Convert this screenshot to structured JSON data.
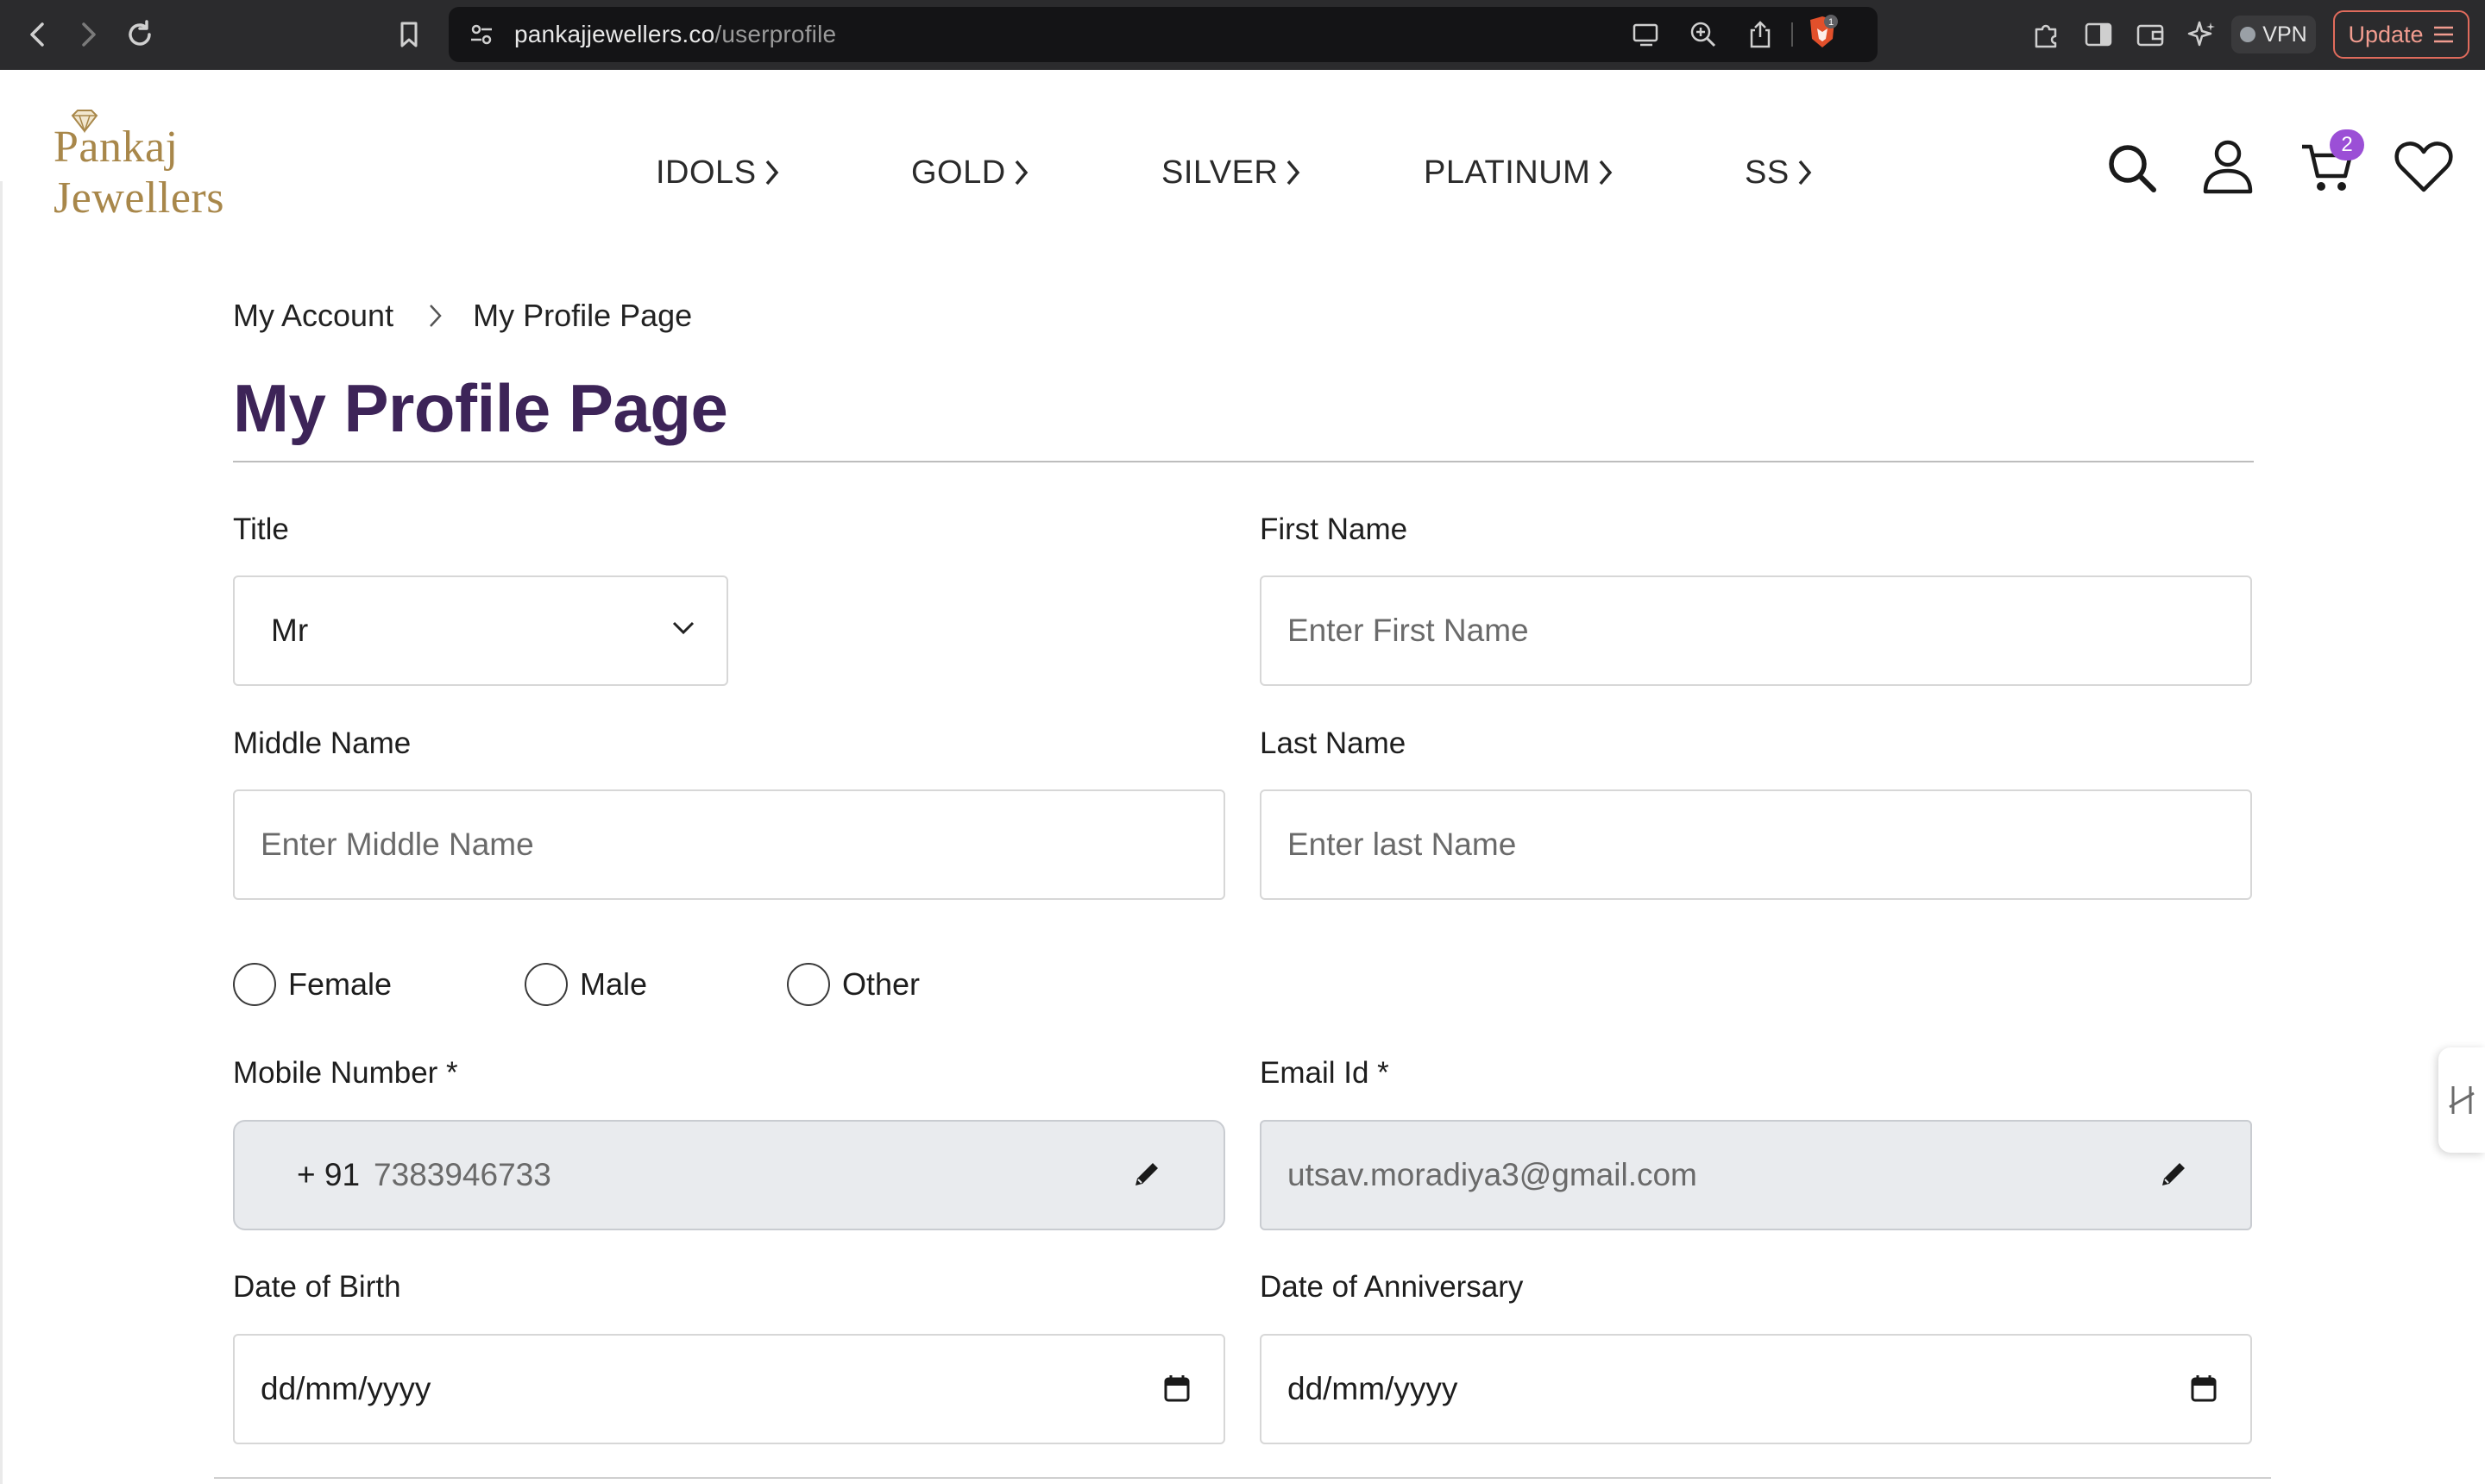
{
  "browser": {
    "url_host": "pankajjewellers.co",
    "url_path": "/userprofile",
    "extension_badge": "1",
    "vpn_label": "VPN",
    "update_label": "Update"
  },
  "site": {
    "logo_text": "Pankaj Jewellers",
    "nav": [
      {
        "label": "IDOLS"
      },
      {
        "label": "GOLD"
      },
      {
        "label": "SILVER"
      },
      {
        "label": "PLATINUM"
      },
      {
        "label": "SS"
      }
    ],
    "cart_count": "2",
    "colors": {
      "title": "#3d2458",
      "logo": "#a8874a",
      "badge": "#9b4fd6"
    }
  },
  "breadcrumb": {
    "parent": "My Account",
    "current": "My Profile Page"
  },
  "page_title": "My Profile Page",
  "form": {
    "title": {
      "label": "Title",
      "value": "Mr"
    },
    "first_name": {
      "label": "First Name",
      "placeholder": "Enter First Name"
    },
    "middle_name": {
      "label": "Middle Name",
      "placeholder": "Enter Middle Name"
    },
    "last_name": {
      "label": "Last Name",
      "placeholder": "Enter last Name"
    },
    "gender_options": [
      "Female",
      "Male",
      "Other"
    ],
    "mobile": {
      "label": "Mobile Number *",
      "country_code": "+ 91",
      "value": "7383946733"
    },
    "email": {
      "label": "Email Id *",
      "value": "utsav.moradiya3@gmail.com"
    },
    "dob": {
      "label": "Date of Birth",
      "placeholder": "dd/mm/yyyy"
    },
    "anniversary": {
      "label": "Date of Anniversary",
      "placeholder": "dd/mm/yyyy"
    }
  }
}
